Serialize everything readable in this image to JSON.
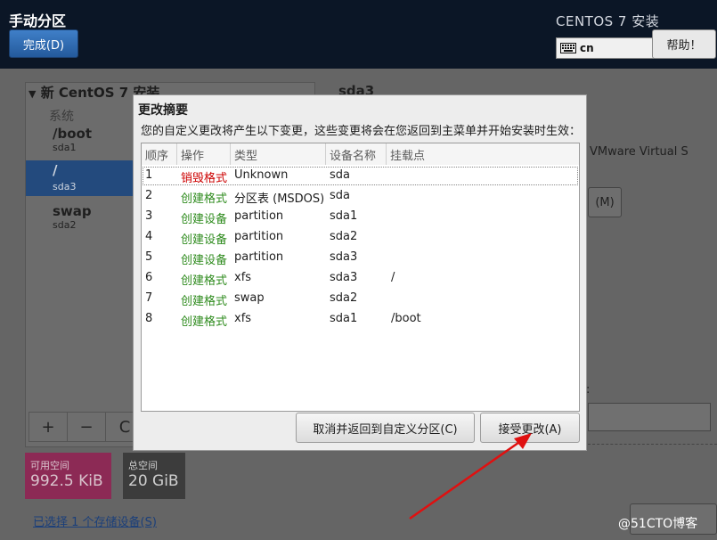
{
  "header": {
    "page_title": "手动分区",
    "done_button": "完成(D)",
    "install_title": "CENTOS 7 安装",
    "keyboard_layout": "cn",
    "help_button": "帮助！"
  },
  "left_panel": {
    "new_install_label": "新 CentOS 7 安装",
    "system_label": "系统",
    "partitions": [
      {
        "mount": "/boot",
        "device": "sda1"
      },
      {
        "mount": "/",
        "device": "sda3"
      },
      {
        "mount": "swap",
        "device": "sda2"
      }
    ],
    "toolbar": {
      "add": "+",
      "remove": "−",
      "refresh": "C"
    },
    "available_space_label": "可用空间",
    "available_space_value": "992.5 KiB",
    "total_space_label": "总空间",
    "total_space_value": "20 GiB",
    "storage_link": "已选择 1 个存储设备(S)"
  },
  "right_panel": {
    "title": "sda3",
    "device_desc": "VMware Virtual S",
    "button_label": "(M)",
    "colon": ":"
  },
  "dialog": {
    "title": "更改摘要",
    "message": "您的自定义更改将产生以下变更，这些变更将会在您返回到主菜单并开始安装时生效：",
    "columns": [
      "顺序",
      "操作",
      "类型",
      "设备名称",
      "挂载点"
    ],
    "rows": [
      {
        "order": "1",
        "action": "销毁格式",
        "action_kind": "destroy",
        "type": "Unknown",
        "device": "sda",
        "mount": ""
      },
      {
        "order": "2",
        "action": "创建格式",
        "action_kind": "create",
        "type": "分区表 (MSDOS)",
        "device": "sda",
        "mount": ""
      },
      {
        "order": "3",
        "action": "创建设备",
        "action_kind": "create",
        "type": "partition",
        "device": "sda1",
        "mount": ""
      },
      {
        "order": "4",
        "action": "创建设备",
        "action_kind": "create",
        "type": "partition",
        "device": "sda2",
        "mount": ""
      },
      {
        "order": "5",
        "action": "创建设备",
        "action_kind": "create",
        "type": "partition",
        "device": "sda3",
        "mount": ""
      },
      {
        "order": "6",
        "action": "创建格式",
        "action_kind": "create",
        "type": "xfs",
        "device": "sda3",
        "mount": "/"
      },
      {
        "order": "7",
        "action": "创建格式",
        "action_kind": "create",
        "type": "swap",
        "device": "sda2",
        "mount": ""
      },
      {
        "order": "8",
        "action": "创建格式",
        "action_kind": "create",
        "type": "xfs",
        "device": "sda1",
        "mount": "/boot"
      }
    ],
    "cancel_button": "取消并返回到自定义分区(C)",
    "accept_button": "接受更改(A)"
  },
  "watermark": "@51CTO博客",
  "colors": {
    "destroy": "#cc0000",
    "create": "#2e8b1d",
    "header_bg": "#0b1626",
    "accent": "#2d6bb5"
  }
}
